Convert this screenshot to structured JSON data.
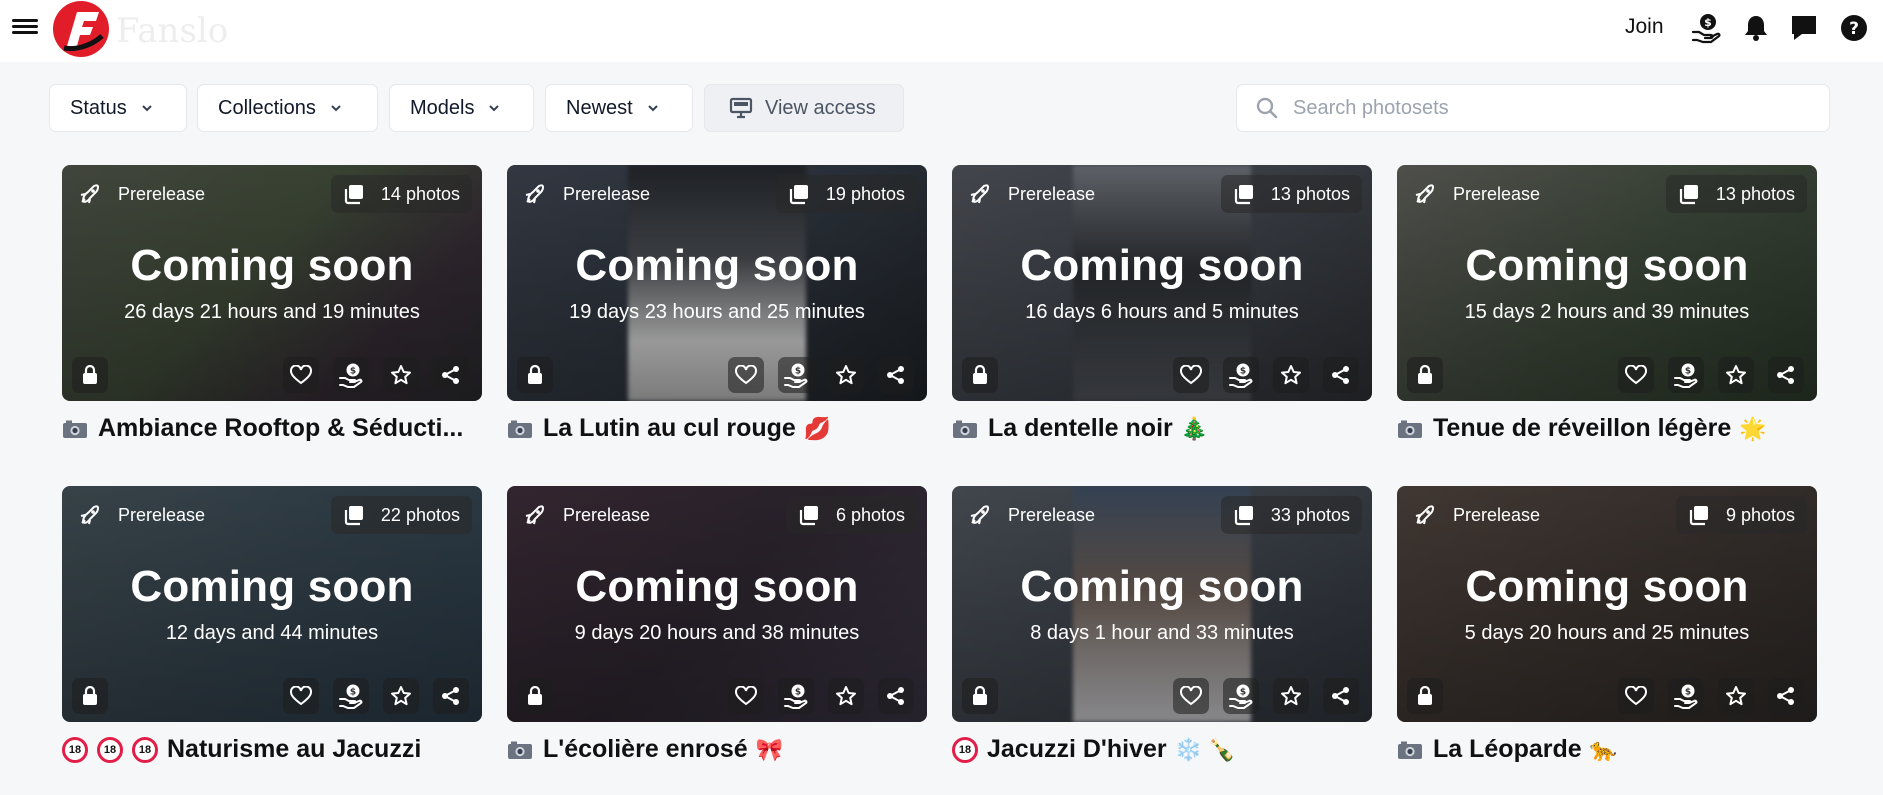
{
  "header": {
    "join_label": "Join",
    "icons": [
      "menu-icon",
      "tip-money-icon",
      "bell-icon",
      "chat-icon",
      "help-icon"
    ]
  },
  "filters": {
    "status": "Status",
    "collections": "Collections",
    "models": "Models",
    "sort": "Newest",
    "view_access": "View access",
    "search_placeholder": "Search photosets"
  },
  "colors": {
    "accent_red": "#e11d2a",
    "badge_bg": "#282828"
  },
  "cards": [
    {
      "badge": "Prerelease",
      "photos": "14 photos",
      "status": "Coming soon",
      "countdown": "26 days 21 hours and 19 minutes",
      "title": "Ambiance Rooftop & Séducti...",
      "prefix": "camera",
      "emoji": ""
    },
    {
      "badge": "Prerelease",
      "photos": "19 photos",
      "status": "Coming soon",
      "countdown": "19 days 23 hours and 25 minutes",
      "title": "La Lutin au cul rouge",
      "prefix": "camera",
      "emoji": "💋"
    },
    {
      "badge": "Prerelease",
      "photos": "13 photos",
      "status": "Coming soon",
      "countdown": "16 days 6 hours and 5 minutes",
      "title": "La dentelle noir",
      "prefix": "camera",
      "emoji": "🎄"
    },
    {
      "badge": "Prerelease",
      "photos": "13 photos",
      "status": "Coming soon",
      "countdown": "15 days 2 hours and 39 minutes",
      "title": "Tenue de réveillon légère",
      "prefix": "camera",
      "emoji": "🌟"
    },
    {
      "badge": "Prerelease",
      "photos": "22 photos",
      "status": "Coming soon",
      "countdown": "12 days and 44 minutes",
      "title": "Naturisme au Jacuzzi",
      "prefix": "adult3",
      "emoji": ""
    },
    {
      "badge": "Prerelease",
      "photos": "6 photos",
      "status": "Coming soon",
      "countdown": "9 days 20 hours and 38 minutes",
      "title": "L'écolière enrosé",
      "prefix": "camera",
      "emoji": "🎀"
    },
    {
      "badge": "Prerelease",
      "photos": "33 photos",
      "status": "Coming soon",
      "countdown": "8 days 1 hour and 33 minutes",
      "title": "Jacuzzi D'hiver",
      "prefix": "adult1",
      "emoji": "❄️ 🍾"
    },
    {
      "badge": "Prerelease",
      "photos": "9 photos",
      "status": "Coming soon",
      "countdown": "5 days 20 hours and 25 minutes",
      "title": "La Léoparde",
      "prefix": "camera",
      "emoji": "🐆"
    }
  ]
}
